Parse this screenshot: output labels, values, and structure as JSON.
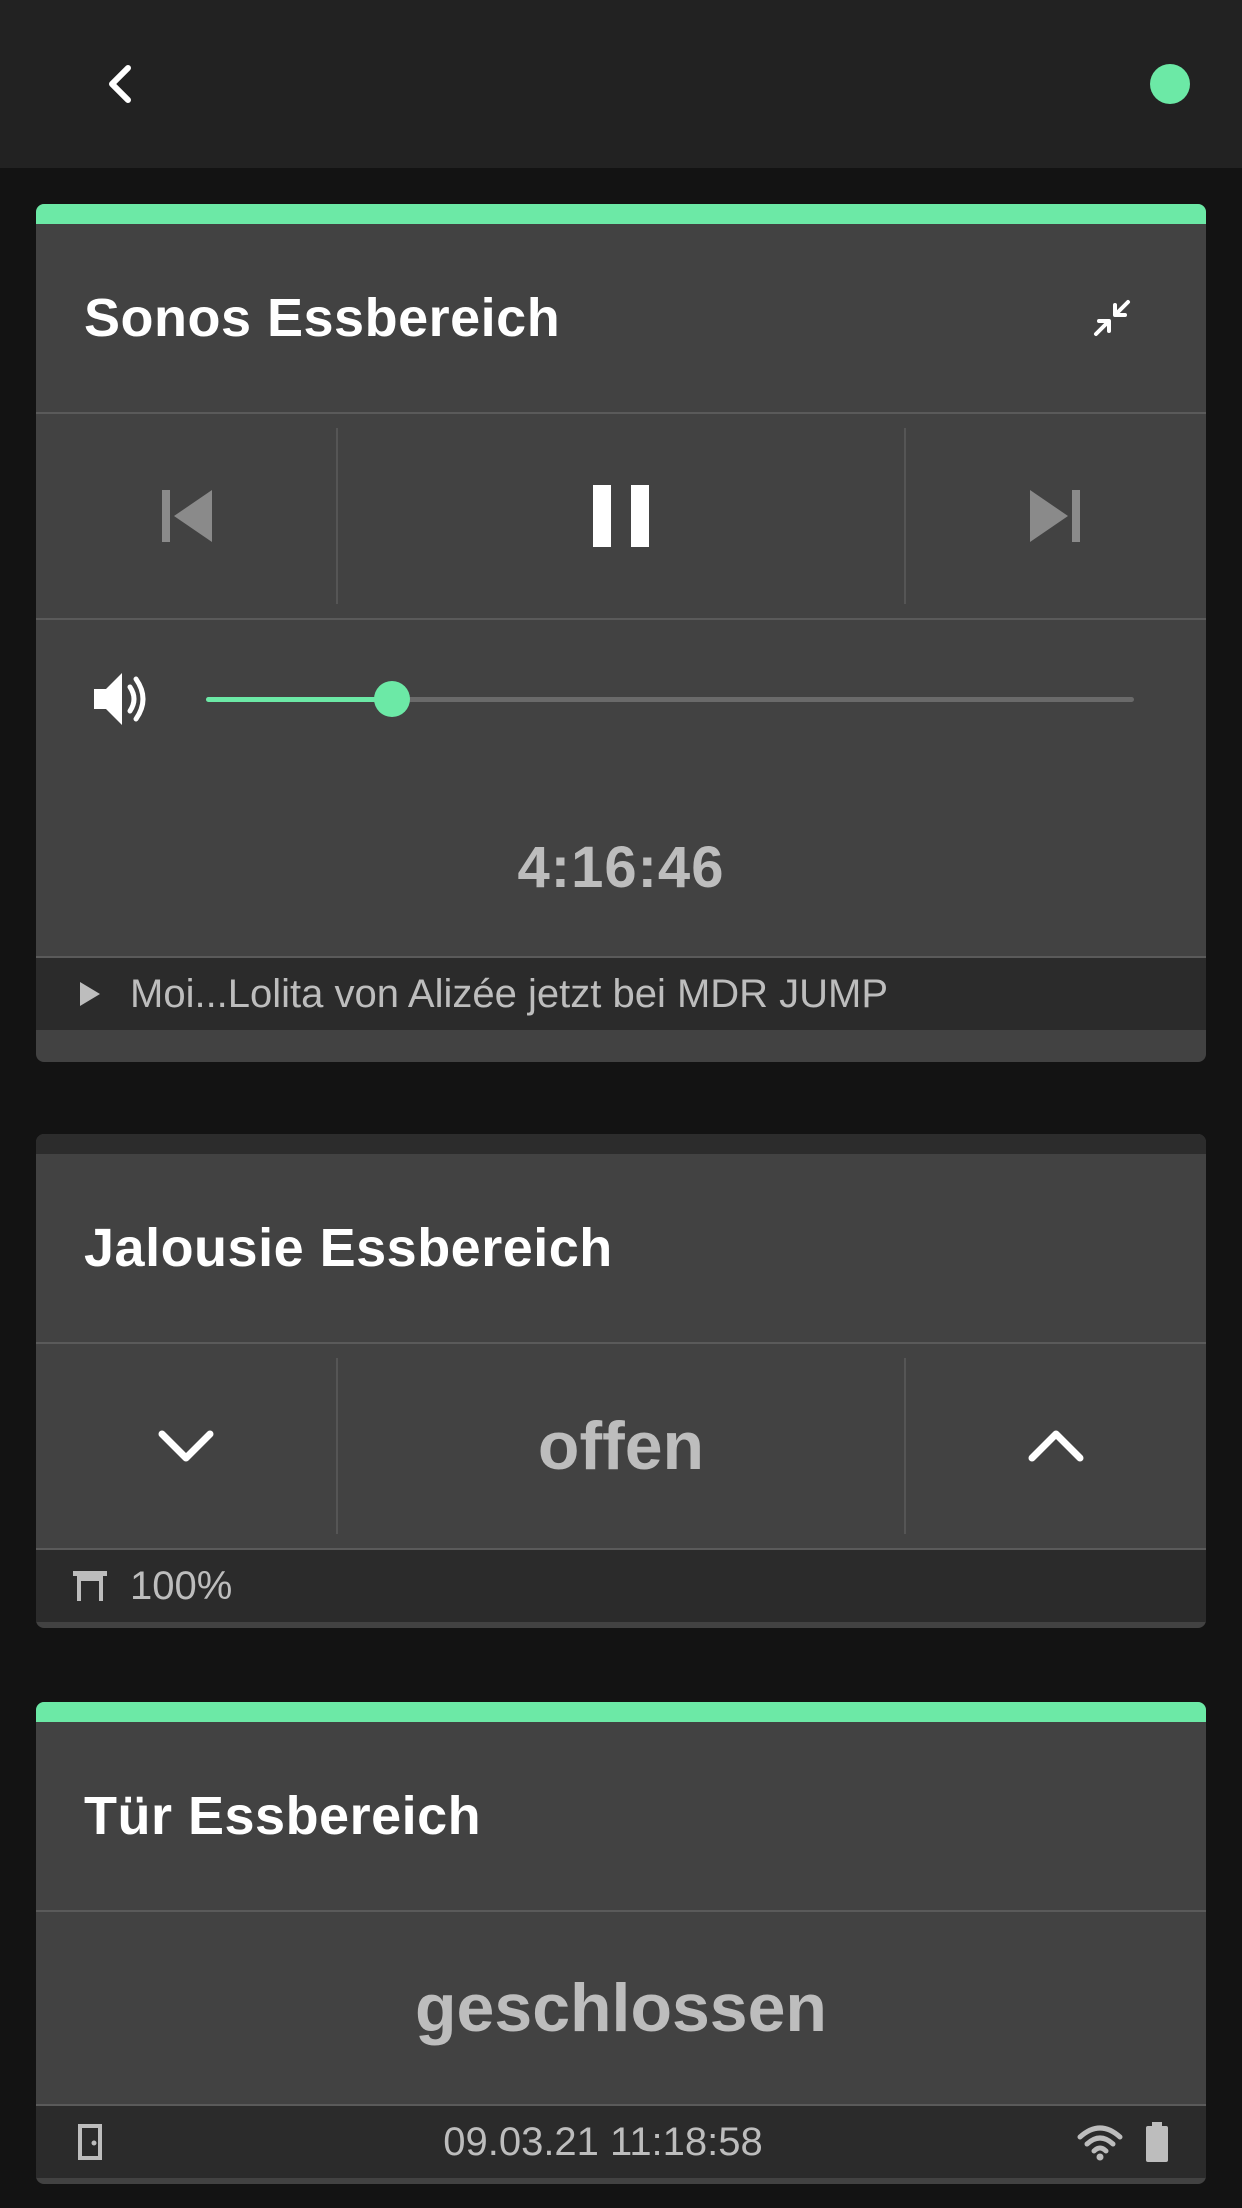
{
  "colors": {
    "accent": "#6ce9a6",
    "background": "#131313",
    "card": "#424242",
    "footer": "#2b2b2b",
    "text_muted": "#bdbdbd"
  },
  "topbar": {
    "back_icon": "chevron-left-icon",
    "status_icon": "status-dot"
  },
  "sonos": {
    "title": "Sonos Essbereich",
    "icons": {
      "collapse": "collapse-icon",
      "previous": "skip-previous-icon",
      "pause": "pause-icon",
      "next": "skip-next-icon",
      "volume": "volume-icon"
    },
    "volume_fraction": 0.2,
    "time": "4:16:46",
    "now_playing": "Moi...Lolita von Alizée jetzt bei MDR JUMP"
  },
  "blind": {
    "title": "Jalousie Essbereich",
    "state": "offen",
    "position": "100%",
    "icons": {
      "down": "chevron-down-icon",
      "up": "chevron-up-icon",
      "blind": "blind-icon"
    }
  },
  "door": {
    "title": "Tür Essbereich",
    "state": "geschlossen",
    "timestamp": "09.03.21 11:18:58",
    "icons": {
      "door": "door-icon",
      "wifi": "wifi-icon",
      "battery": "battery-icon"
    }
  }
}
